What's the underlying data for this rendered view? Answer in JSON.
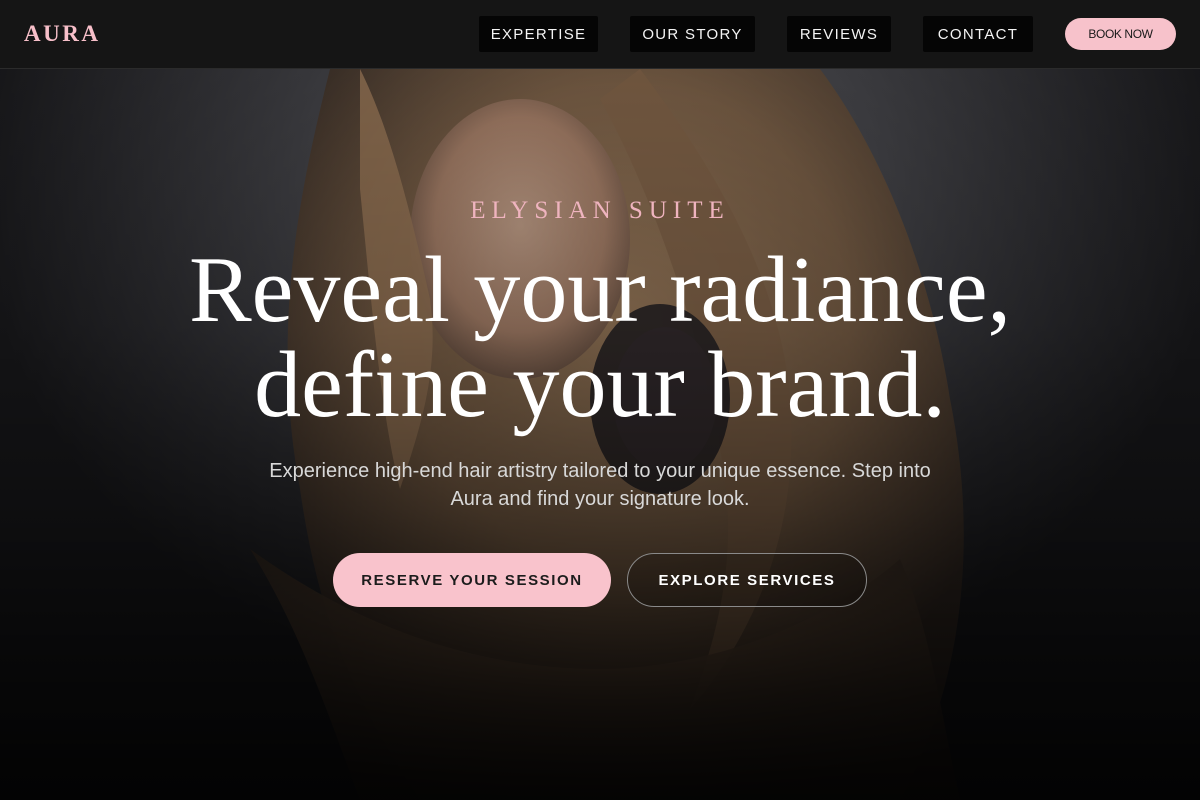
{
  "brand": {
    "logo": "AURA"
  },
  "nav": {
    "items": [
      {
        "label": "EXPERTISE"
      },
      {
        "label": "OUR STORY"
      },
      {
        "label": "REVIEWS"
      },
      {
        "label": "CONTACT"
      }
    ],
    "book_label": "BOOK NOW"
  },
  "hero": {
    "eyebrow": "ELYSIAN SUITE",
    "headline_line1": "Reveal your radiance,",
    "headline_line2": "define your brand.",
    "subtext": "Experience high-end hair artistry tailored to your unique essence. Step into Aura and find your signature look.",
    "primary_cta": "RESERVE YOUR SESSION",
    "secondary_cta": "EXPLORE SERVICES"
  },
  "colors": {
    "accent_pink": "#f7c2cb",
    "nav_background": "#151515",
    "nav_button_background": "#050505",
    "headline_text": "#ffffff"
  }
}
